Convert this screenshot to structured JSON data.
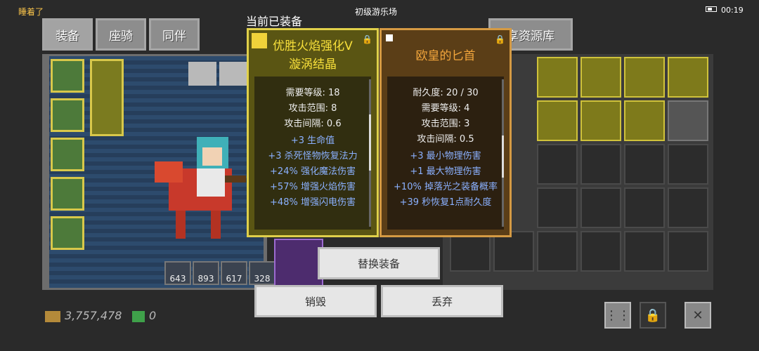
{
  "status_bar": {
    "left_text": "睡着了",
    "center_text": "初级游乐场",
    "time": "00:19"
  },
  "tabs": [
    "装备",
    "座骑",
    "同伴",
    "享资源库"
  ],
  "panel_title": "当前已装备",
  "equipped_item": {
    "name_line1": "优胜火焰强化V",
    "name_line2": "漩涡结晶",
    "stats": [
      "需要等级: 18",
      "攻击范围: 8",
      "攻击间隔: 0.6"
    ],
    "bonuses": [
      "+3 生命值",
      "+3 杀死怪物恢复法力",
      "+24% 强化魔法伤害",
      "+57% 增强火焰伤害",
      "+48% 增强闪电伤害"
    ]
  },
  "compare_item": {
    "name": "欧皇的匕首",
    "stats": [
      "耐久度: 20 / 30",
      "需要等级: 4",
      "攻击范围: 3",
      "攻击间隔: 0.5"
    ],
    "bonuses": [
      "+3 最小物理伤害",
      "+1 最大物理伤害",
      "+10% 掉落光之装备概率",
      "+39 秒恢复1点耐久度"
    ]
  },
  "buttons": {
    "replace": "替换装备",
    "destroy": "销毁",
    "discard": "丢弃"
  },
  "stacks": [
    "643",
    "893",
    "617",
    "328"
  ],
  "currency": {
    "gold": "3,757,478",
    "gems": "0"
  },
  "colors": {
    "bonus": "#8bb1ff",
    "equipped_border": "#e0d04a",
    "compare_border": "#d59a43"
  }
}
